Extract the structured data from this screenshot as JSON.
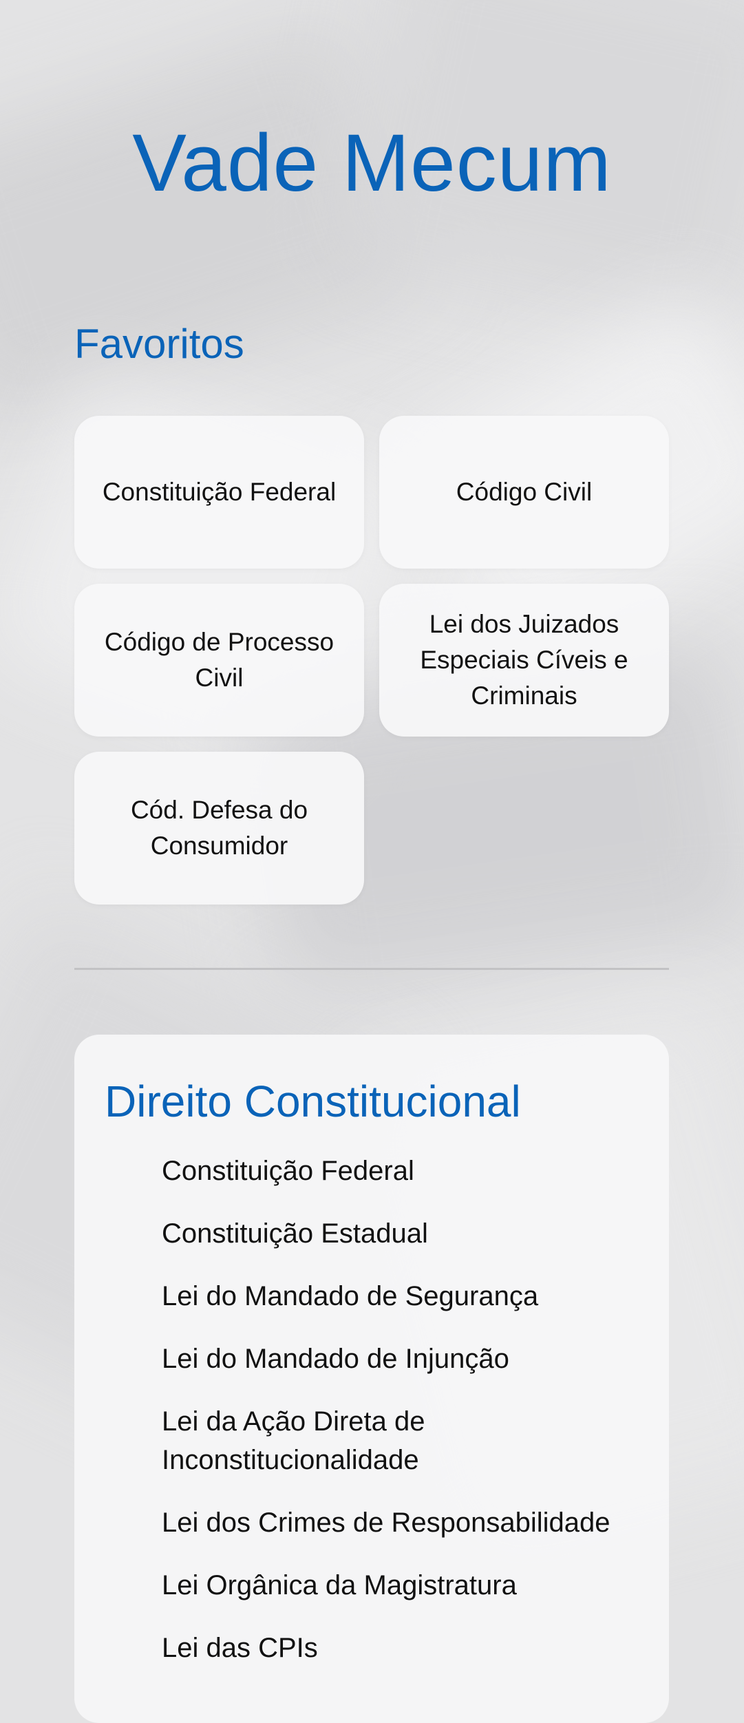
{
  "app": {
    "title": "Vade Mecum"
  },
  "favorites": {
    "title": "Favoritos",
    "items": [
      {
        "label": "Constituição Federal"
      },
      {
        "label": "Código Civil"
      },
      {
        "label": "Código de Processo Civil"
      },
      {
        "label": "Lei dos Juizados Especiais Cíveis e Criminais"
      },
      {
        "label": "Cód. Defesa do Consumidor"
      }
    ]
  },
  "category": {
    "title": "Direito Constitucional",
    "items": [
      {
        "label": "Constituição Federal"
      },
      {
        "label": "Constituição Estadual"
      },
      {
        "label": "Lei do Mandado de Segurança"
      },
      {
        "label": "Lei do Mandado de Injunção"
      },
      {
        "label": "Lei da Ação Direta de Inconstitucionalidade"
      },
      {
        "label": "Lei dos Crimes de Responsabilidade"
      },
      {
        "label": "Lei Orgânica da Magistratura"
      },
      {
        "label": "Lei das CPIs"
      }
    ]
  },
  "colors": {
    "accent": "#0a63b8",
    "background": "#e3e3e4",
    "card": "#f6f6f7",
    "divider": "#c2c2c4"
  }
}
